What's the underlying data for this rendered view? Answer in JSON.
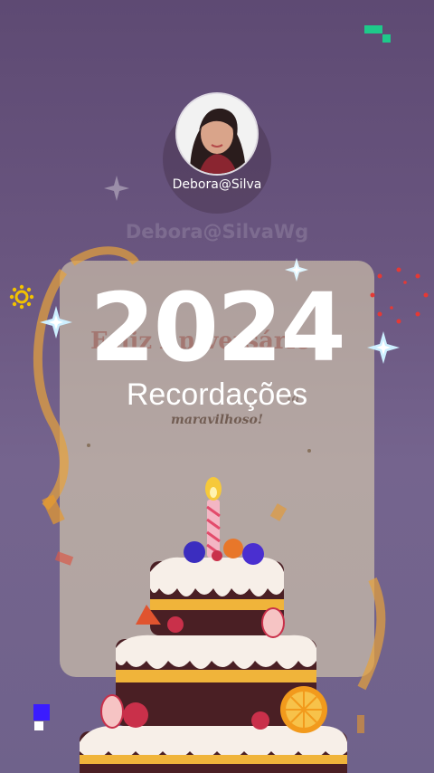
{
  "profile": {
    "username": "Debora@Silva",
    "ghost_username": "Debora@SilvaWg"
  },
  "hero": {
    "year": "2024",
    "subtitle": "Recordações"
  },
  "card": {
    "greeting_partial": "Feliz Aniversário",
    "message_partial": "Um dia maravilhoso!",
    "message_line2": "maravilhoso!"
  },
  "colors": {
    "background_top": "#5e4a73",
    "background_bottom": "#6f628b",
    "card": "#e8dcb4",
    "accent_green": "#1ec98a",
    "accent_blue": "#3a1cff",
    "sparkle_dots": "#e53935"
  },
  "icons": [
    "sparkle-icon",
    "sun-icon",
    "dotted-ring-icon",
    "pixel-icon",
    "birthday-cake-illustration"
  ]
}
